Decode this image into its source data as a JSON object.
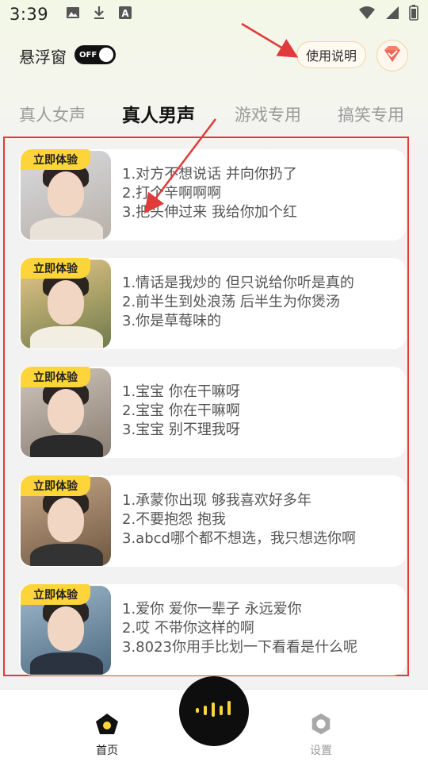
{
  "status_bar": {
    "time": "3:39",
    "icons": [
      "image-icon",
      "download-icon",
      "font-icon",
      "wifi-icon",
      "signal-icon",
      "battery-icon"
    ]
  },
  "header": {
    "float_window_label": "悬浮窗",
    "toggle_state": "OFF",
    "help_button_label": "使用说明",
    "vip_icon": "diamond-icon"
  },
  "tabs": [
    {
      "label": "真人女声",
      "active": false
    },
    {
      "label": "真人男声",
      "active": true
    },
    {
      "label": "游戏专用",
      "active": false
    },
    {
      "label": "搞笑专用",
      "active": false
    }
  ],
  "cards": [
    {
      "badge": "立即体验",
      "lines": [
        "1.对方不想说话 并向你扔了",
        "2.打个辛啊啊啊",
        "3.把头伸过来 我给你加个红"
      ]
    },
    {
      "badge": "立即体验",
      "lines": [
        "1.情话是我炒的 但只说给你听是真的",
        "2.前半生到处浪荡 后半生为你煲汤",
        "3.你是草莓味的"
      ]
    },
    {
      "badge": "立即体验",
      "lines": [
        "1.宝宝 你在干嘛呀",
        "2.宝宝 你在干嘛啊",
        "3.宝宝 别不理我呀"
      ]
    },
    {
      "badge": "立即体验",
      "lines": [
        "1.承蒙你出现 够我喜欢好多年",
        "2.不要抱怨 抱我",
        "3.abcd哪个都不想选，我只想选你啊"
      ]
    },
    {
      "badge": "立即体验",
      "lines": [
        "1.爱你 爱你一辈子 永远爱你",
        "2.哎 不带你这样的啊",
        "3.8023你用手比划一下看看是什么呢"
      ]
    }
  ],
  "bottom_nav": {
    "home_label": "首页",
    "settings_label": "设置"
  },
  "colors": {
    "accent_yellow": "#fdd53a",
    "annotation_red": "#e03a3a"
  }
}
